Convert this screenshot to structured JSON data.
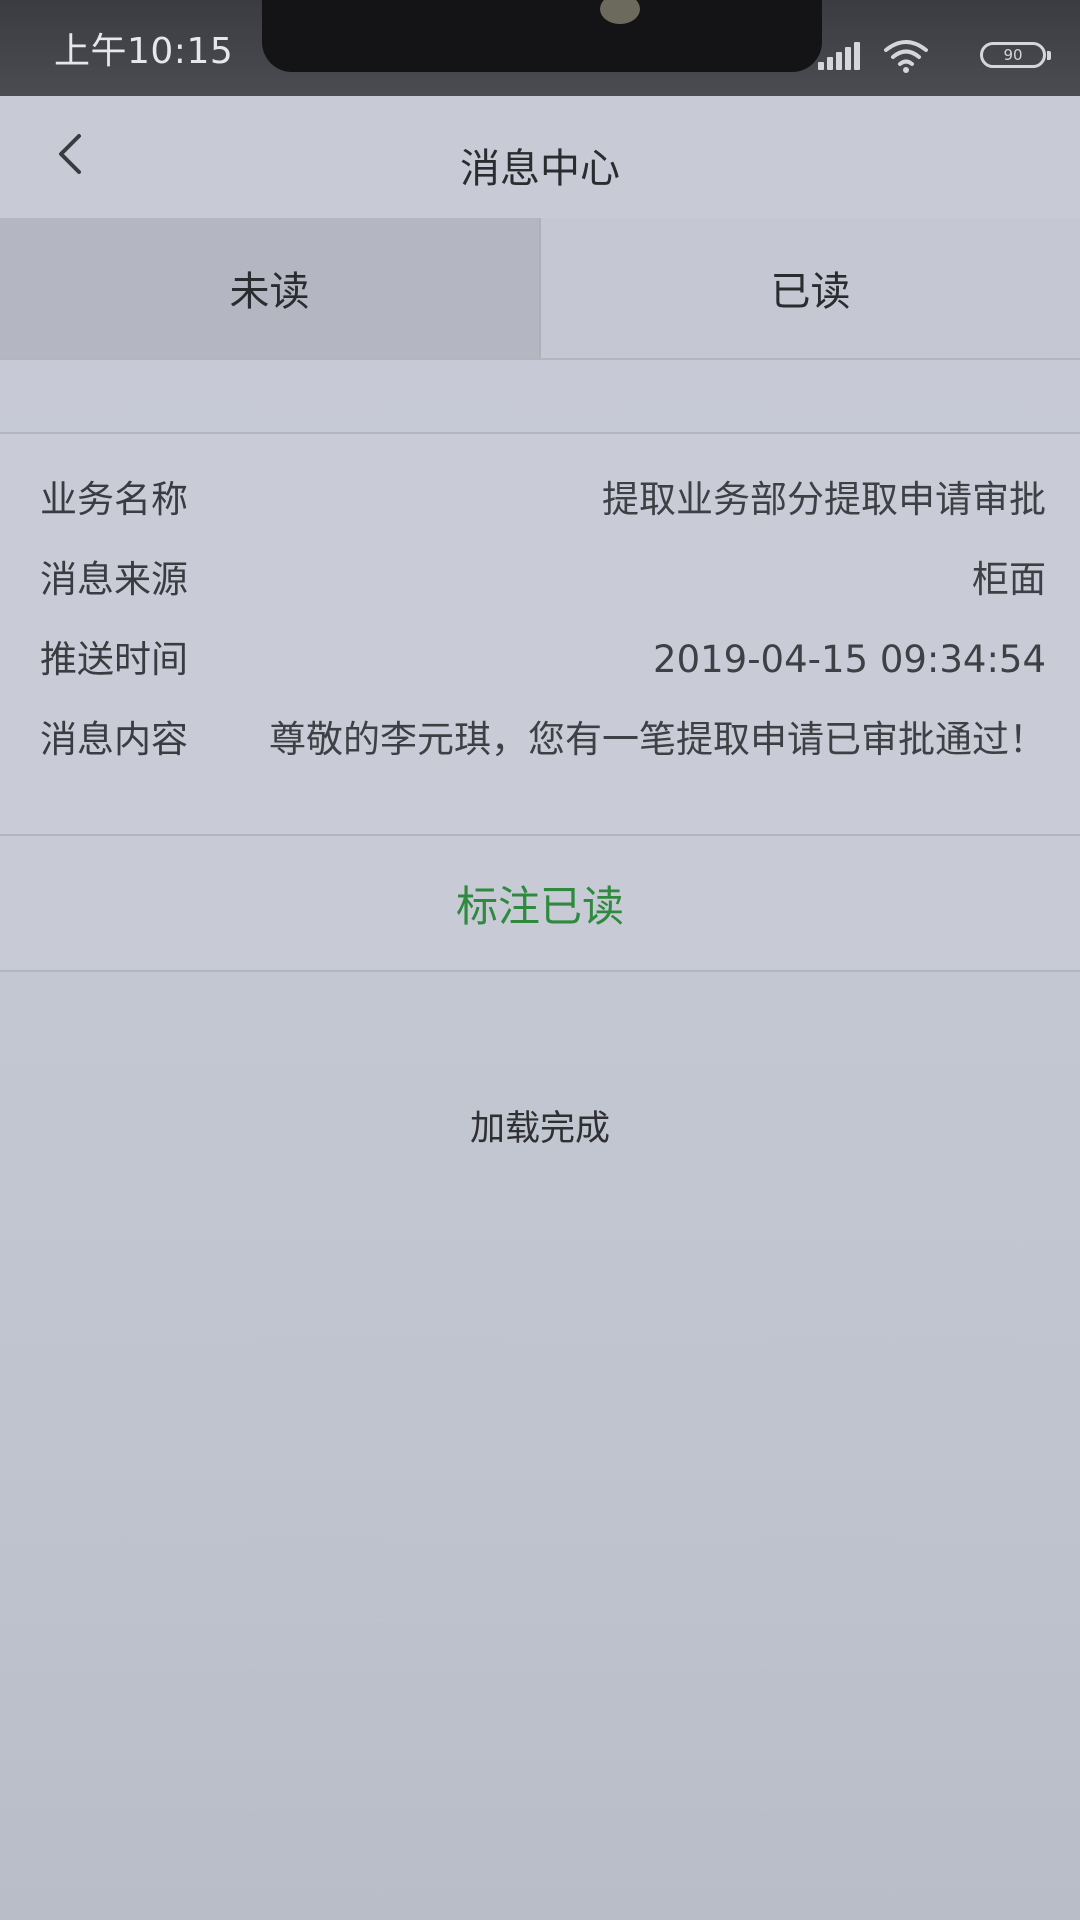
{
  "status_bar": {
    "time": "上午10:15",
    "battery": "90",
    "icons": [
      "signal-icon",
      "wifi-icon",
      "battery-icon"
    ]
  },
  "nav": {
    "title": "消息中心",
    "back_icon": "chevron-left-icon"
  },
  "tabs": [
    {
      "label": "未读",
      "active": true
    },
    {
      "label": "已读",
      "active": false
    }
  ],
  "message": {
    "fields": [
      {
        "label": "业务名称",
        "value": "提取业务部分提取申请审批"
      },
      {
        "label": "消息来源",
        "value": "柜面"
      },
      {
        "label": "推送时间",
        "value": "2019-04-15 09:34:54"
      },
      {
        "label": "消息内容",
        "value": "尊敬的李元琪，您有一笔提取申请已审批通过！"
      }
    ],
    "action_label": "标注已读"
  },
  "list_status": "加载完成",
  "colors": {
    "accent_green": "#2f8a3f",
    "status_bar": "#3a3c41",
    "background": "#c8cbd6"
  }
}
